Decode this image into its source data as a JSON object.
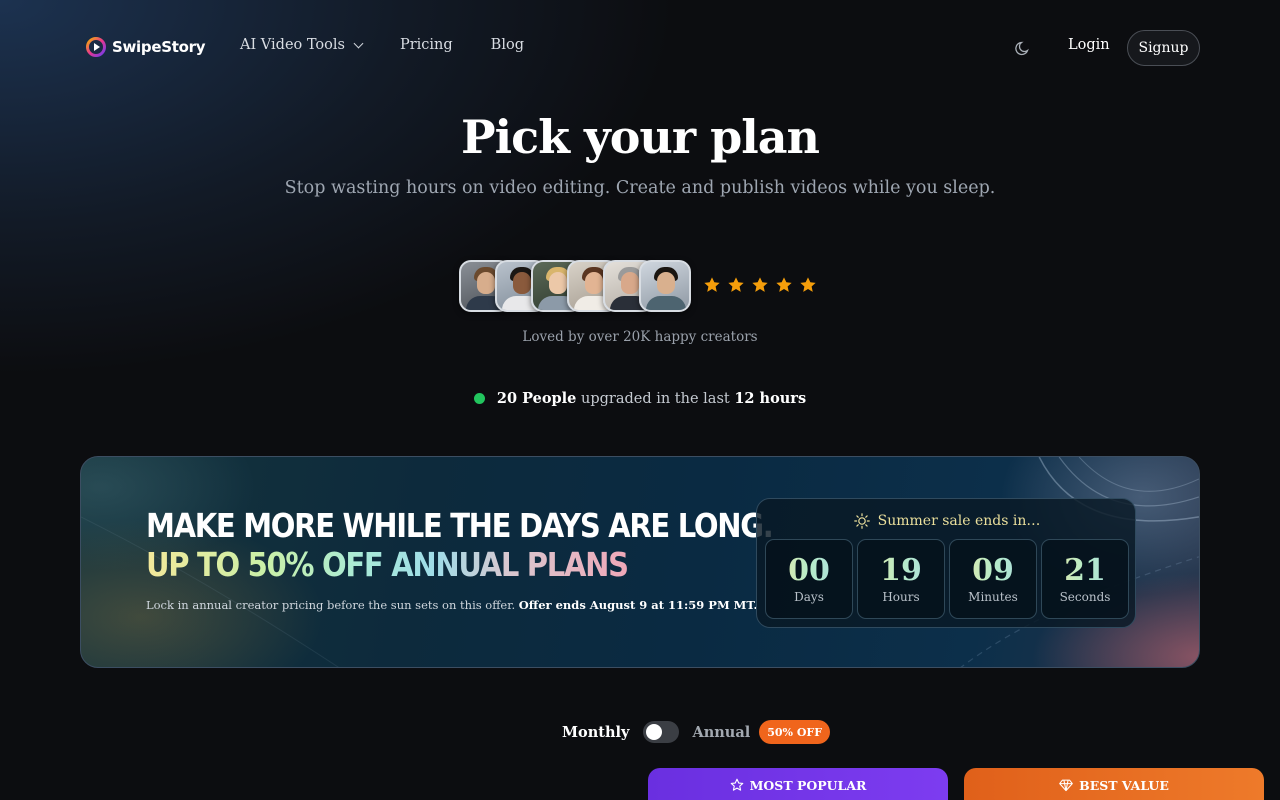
{
  "nav": {
    "logo_text": "SwipeStory",
    "links": [
      {
        "label": "AI Video Tools",
        "has_dropdown": true
      },
      {
        "label": "Pricing"
      },
      {
        "label": "Blog"
      }
    ],
    "theme_icon": "moon-icon",
    "login": "Login",
    "signup": "Signup"
  },
  "hero": {
    "title": "Pick your plan",
    "subtitle": "Stop wasting hours on video editing. Create and publish videos while you sleep.",
    "rating_stars": 5,
    "loved_text": "Loved by over 20K happy creators",
    "upgraded": {
      "count": "20 People",
      "middle": "upgraded in the last",
      "period": "12 hours"
    }
  },
  "banner": {
    "headline": "MAKE MORE WHILE THE DAYS ARE LONG.",
    "highlight": "UP TO 50% OFF ANNUAL PLANS",
    "description": "Lock in annual creator pricing before the sun sets on this offer.",
    "offer_ends": "Offer ends August 9 at 11:59 PM MT.",
    "countdown_title": "Summer sale ends in…",
    "countdown": [
      {
        "value": "00",
        "label": "Days"
      },
      {
        "value": "19",
        "label": "Hours"
      },
      {
        "value": "09",
        "label": "Minutes"
      },
      {
        "value": "21",
        "label": "Seconds"
      }
    ]
  },
  "billing": {
    "monthly": "Monthly",
    "annual": "Annual",
    "badge": "50% OFF",
    "annual_selected": false
  },
  "plans": {
    "popular_label": "MOST POPULAR",
    "value_label": "BEST VALUE"
  },
  "colors": {
    "accent_purple": "#7d3cf0",
    "accent_orange": "#ee7a2a",
    "star": "#f59e0b",
    "online_dot": "#22c55e"
  }
}
